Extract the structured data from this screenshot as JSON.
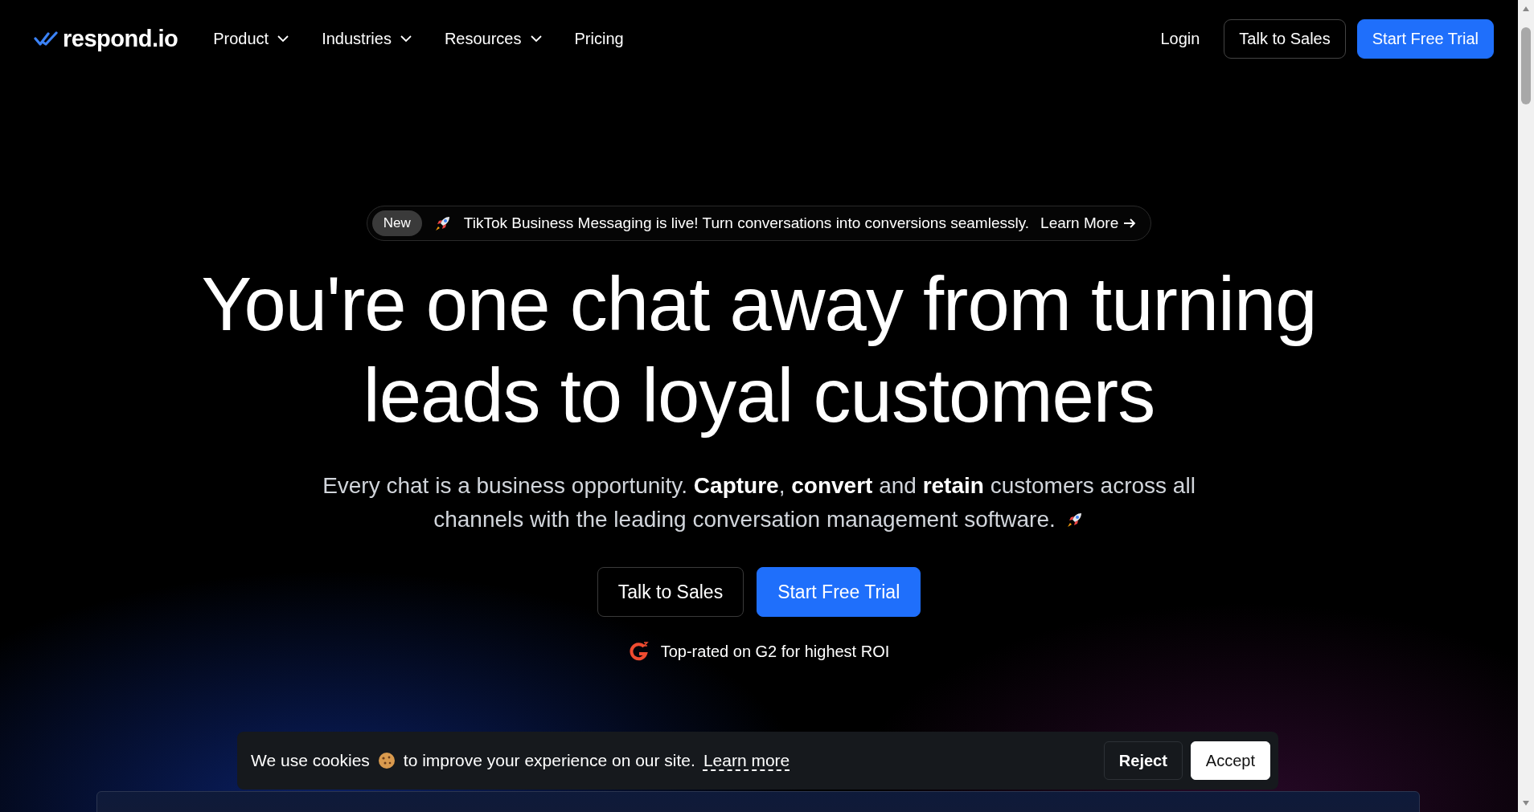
{
  "nav": {
    "logo": "respond.io",
    "links": [
      {
        "label": "Product",
        "dropdown": true
      },
      {
        "label": "Industries",
        "dropdown": true
      },
      {
        "label": "Resources",
        "dropdown": true
      },
      {
        "label": "Pricing",
        "dropdown": false
      }
    ],
    "login": "Login",
    "talk": "Talk to Sales",
    "trial": "Start Free Trial"
  },
  "announcement": {
    "badge": "New",
    "text": "TikTok Business Messaging is live! Turn conversations into conversions seamlessly.",
    "link": "Learn More"
  },
  "hero": {
    "headline": "You're one chat away from turning leads to loyal customers",
    "subtitle_lines": [
      "Every chat is a business opportunity. **Capture**, **convert** and **retain** customers across all",
      "channels with the leading conversation management software."
    ],
    "talk": "Talk to Sales",
    "trial": "Start Free Trial",
    "rating": "Top-rated on G2 for highest ROI"
  },
  "cookie": {
    "before": "We use cookies",
    "after": "to improve your experience on our site.",
    "link": "Learn more",
    "reject": "Reject",
    "accept": "Accept"
  }
}
